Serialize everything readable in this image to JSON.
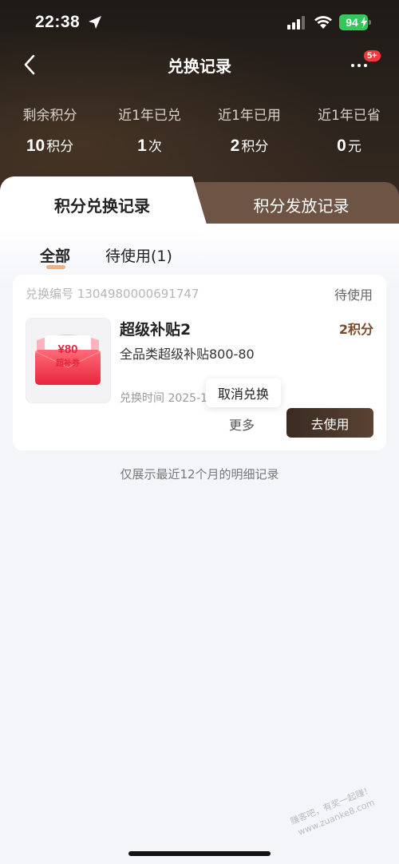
{
  "status_bar": {
    "time": "22:38",
    "battery": "94"
  },
  "nav": {
    "title": "兑换记录",
    "badge": "5+"
  },
  "stats": [
    {
      "label": "剩余积分",
      "value": "10",
      "unit": "积分"
    },
    {
      "label": "近1年已兑",
      "value": "1",
      "unit": "次"
    },
    {
      "label": "近1年已用",
      "value": "2",
      "unit": "积分"
    },
    {
      "label": "近1年已省",
      "value": "0",
      "unit": "元"
    }
  ],
  "tabs": {
    "active": "积分兑换记录",
    "inactive": "积分发放记录"
  },
  "filters": {
    "all": "全部",
    "pending": "待使用(1)"
  },
  "order": {
    "number": "兑换编号 1304980000691747",
    "status": "待使用",
    "name": "超级补贴2",
    "price": "2积分",
    "desc": "全品类超级补贴800-80",
    "time": "兑换时间 2025-11",
    "coupon_amount": "¥80",
    "coupon_label": "超补券",
    "popup_action": "取消兑换",
    "more": "更多",
    "use_button": "去使用"
  },
  "footer_note": "仅展示最近12个月的明细记录",
  "watermark": {
    "line1": "赚客吧，有奖一起赚！",
    "line2": "www.zuanke8.com"
  },
  "colors": {
    "accent": "#7a4a2a",
    "badge": "#f23a3a",
    "battery": "#34c759"
  }
}
